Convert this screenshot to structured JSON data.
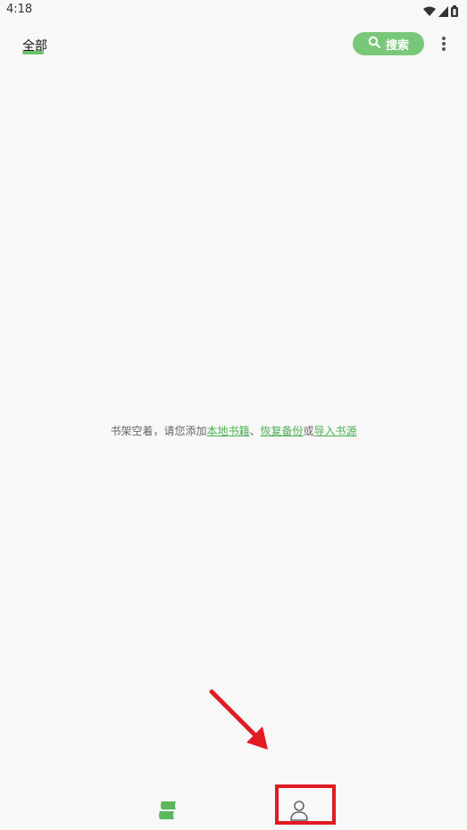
{
  "status_bar": {
    "time": "4:18",
    "icons": [
      "wifi-icon",
      "signal-icon",
      "battery-icon"
    ]
  },
  "header": {
    "tab_label": "全部",
    "search_label": "搜索",
    "search_icon": "search-icon",
    "more_icon": "more-vert-icon"
  },
  "empty_state": {
    "prefix": "书架空着，请您添加",
    "link_local": "本地书籍",
    "sep1": "、",
    "link_restore": "恢复备份",
    "sep2": "或",
    "link_import": "导入书源"
  },
  "bottom_nav": {
    "items": [
      "bookshelf-icon",
      "profile-icon"
    ]
  },
  "colors": {
    "accent": "#6dc06d",
    "highlight": "#e01b22",
    "background": "#f8f8f8"
  }
}
